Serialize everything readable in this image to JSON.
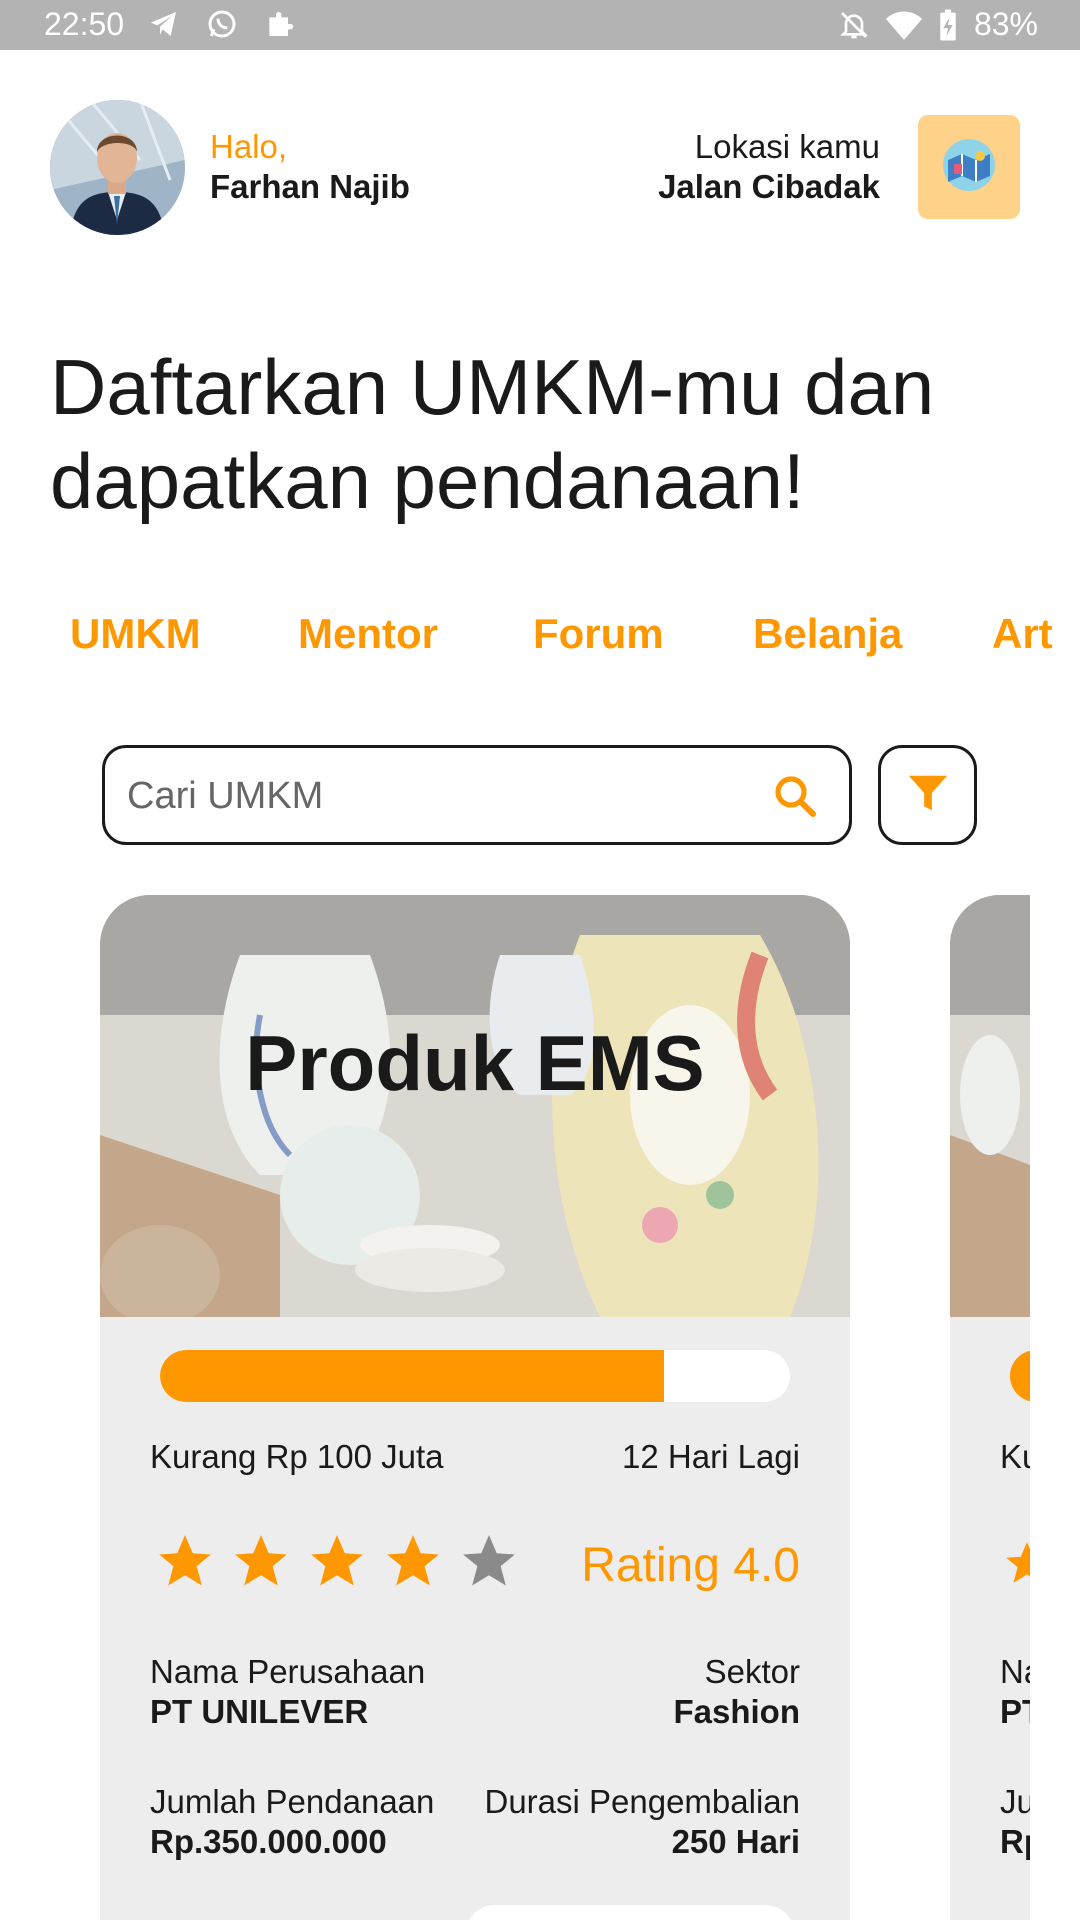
{
  "status_bar": {
    "time": "22:50",
    "left_icons": [
      "telegram-icon",
      "whatsapp-icon",
      "puzzle-icon"
    ],
    "right_icons": [
      "notifications-off-icon",
      "wifi-icon",
      "battery-charging-icon"
    ],
    "battery": "83%"
  },
  "header": {
    "greeting": "Halo,",
    "user_name": "Farhan Najib",
    "location_label": "Lokasi kamu",
    "location_value": "Jalan Cibadak",
    "map_button_icon": "map-icon"
  },
  "headline": "Daftarkan UMKM-mu dan dapatkan pendanaan!",
  "tabs": [
    {
      "label": "UMKM"
    },
    {
      "label": "Mentor"
    },
    {
      "label": "Forum"
    },
    {
      "label": "Belanja"
    },
    {
      "label": "Art"
    }
  ],
  "search": {
    "placeholder": "Cari UMKM",
    "search_icon": "search-icon",
    "filter_icon": "filter-icon"
  },
  "cards": [
    {
      "title": "Produk EMS",
      "progress_fraction": 0.8,
      "remaining": "Kurang Rp 100 Juta",
      "days_left": "12 Hari Lagi",
      "rating_stars": 4,
      "rating_max": 5,
      "rating_text": "Rating 4.0",
      "company_label": "Nama Perusahaan",
      "company_value": "PT UNILEVER",
      "sector_label": "Sektor",
      "sector_value": "Fashion",
      "funding_label": "Jumlah Pendanaan",
      "funding_value": "Rp.350.000.000",
      "duration_label": "Durasi Pengembalian",
      "duration_value": "250 Hari"
    }
  ],
  "peek_card": {
    "remaining_partial": "Ku",
    "company_label_partial": "Na",
    "company_value_partial": "PT",
    "funding_label_partial": "Ju",
    "funding_value_partial": "Rp"
  },
  "colors": {
    "accent": "#ff9800",
    "status_bar": "#b3b3b3",
    "card_bg": "#ededed",
    "text": "#1a1a1a",
    "star_empty": "#8a8a8a"
  }
}
